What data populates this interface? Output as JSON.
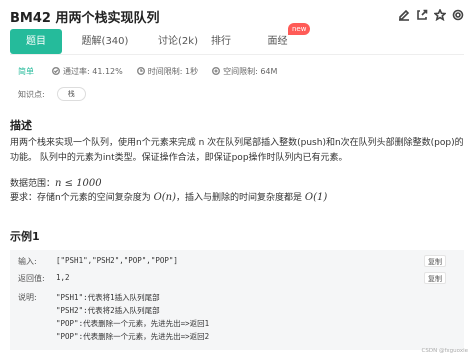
{
  "header": {
    "title": "BM42  用两个栈实现队列"
  },
  "tabs": [
    {
      "label": "题目"
    },
    {
      "label": "题解(340)"
    },
    {
      "label": "讨论(2k)"
    },
    {
      "label": "排行"
    },
    {
      "label": "面经"
    }
  ],
  "new_badge": "new",
  "meta": {
    "difficulty": "简单",
    "pass_rate": "通过率: 41.12%",
    "time_limit": "时间限制: 1秒",
    "space_limit": "空间限制: 64M"
  },
  "knowledge": {
    "label": "知识点:",
    "tag": "栈"
  },
  "description": {
    "title": "描述",
    "text": "用两个栈来实现一个队列，使用n个元素来完成 n 次在队列尾部插入整数(push)和n次在队列头部删除整数(pop)的功能。 队列中的元素为int类型。保证操作合法，即保证pop操作时队列内已有元素。",
    "range_label": "数据范围：",
    "range_math": "n ≤ 1000",
    "req_prefix": "要求：存储n个元素的空间复杂度为 ",
    "req_space": "O(n)",
    "req_middle": "，插入与删除的时间复杂度都是 ",
    "req_time": "O(1)"
  },
  "example": {
    "title": "示例1",
    "input_label": "输入:",
    "input_value": "[\"PSH1\",\"PSH2\",\"POP\",\"POP\"]",
    "output_label": "返回值:",
    "output_value": "1,2",
    "copy_label": "复制",
    "note_label": "说明:",
    "notes": [
      "\"PSH1\":代表将1插入队列尾部",
      "\"PSH2\":代表将2插入队列尾部",
      "\"POP\":代表删除一个元素，先进先出=>返回1",
      "\"POP\":代表删除一个元素，先进先出=>返回2"
    ]
  },
  "watermark": "CSDN @fxguoxie",
  "icons": [
    "edit-icon",
    "share-icon",
    "star-icon",
    "settings-icon"
  ]
}
